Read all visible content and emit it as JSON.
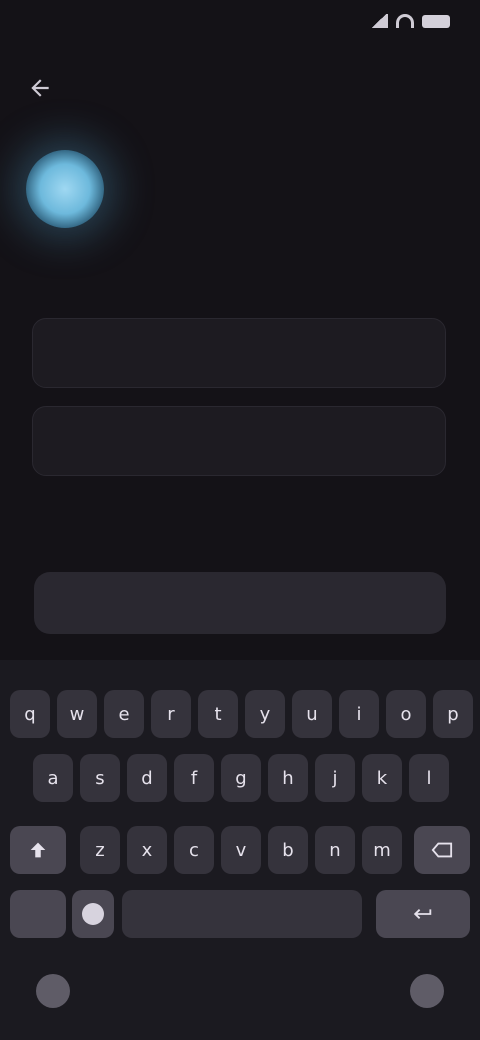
{
  "status": {
    "time": "",
    "icons": [
      "signal-icon",
      "wifi-icon",
      "battery-icon"
    ]
  },
  "header": {
    "back_icon": "arrow-back-icon"
  },
  "brand": {
    "logo_icon": "app-logo-icon"
  },
  "main": {
    "title": "",
    "subtitle": "",
    "field_1": {
      "placeholder": "",
      "value": ""
    },
    "field_2": {
      "placeholder": "",
      "value": ""
    },
    "primary_button": ""
  },
  "keyboard": {
    "row1": [
      "q",
      "w",
      "e",
      "r",
      "t",
      "y",
      "u",
      "i",
      "o",
      "p"
    ],
    "row2": [
      "a",
      "s",
      "d",
      "f",
      "g",
      "h",
      "j",
      "k",
      "l"
    ],
    "row3": [
      "z",
      "x",
      "c",
      "v",
      "b",
      "n",
      "m"
    ],
    "shift_icon": "shift-icon",
    "backspace_icon": "backspace-icon",
    "symbols_label": "",
    "emoji_icon": "emoji-icon",
    "space_label": "",
    "enter_icon": "enter-icon"
  },
  "nav": {
    "left_icon": "keyboard-hide-icon",
    "right_icon": "mic-icon"
  },
  "colors": {
    "background": "#141217",
    "accent": "#6db9dc",
    "key": "#35333c"
  }
}
